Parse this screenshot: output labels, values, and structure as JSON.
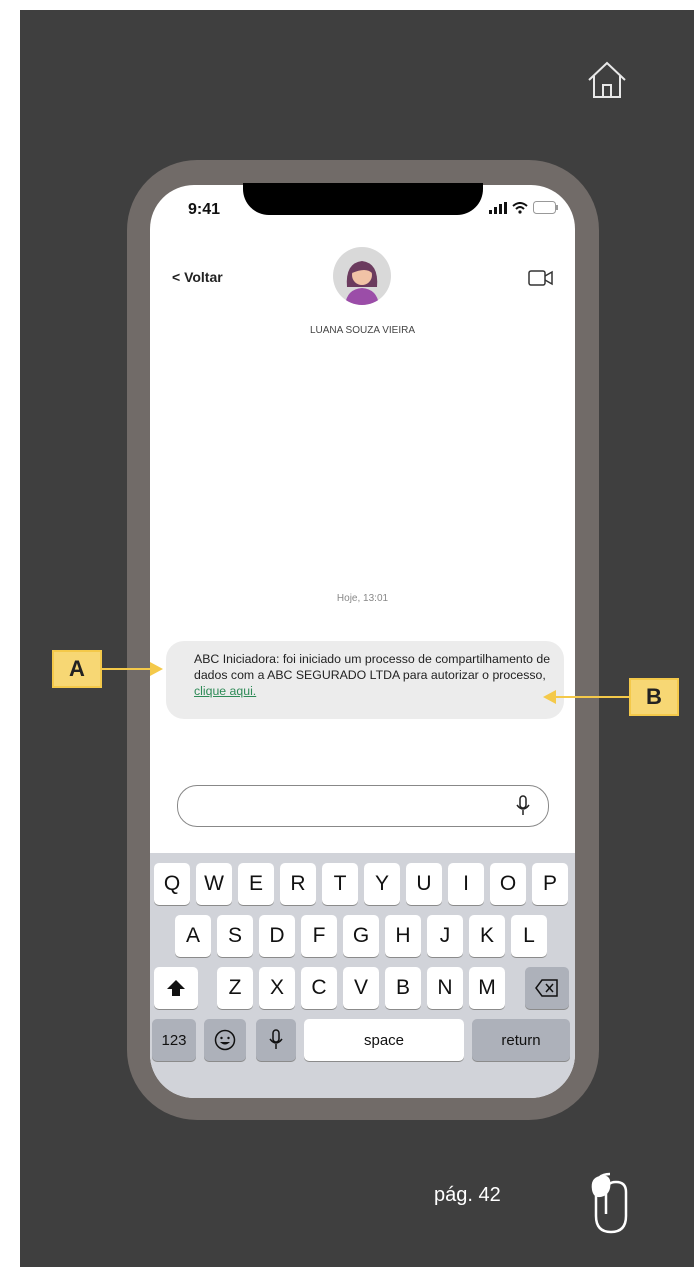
{
  "status_bar": {
    "time": "9:41"
  },
  "header": {
    "back_label": "< Voltar",
    "contact_name": "LUANA SOUZA VIEIRA"
  },
  "chat": {
    "timestamp": "Hoje, 13:01",
    "message_text": "ABC Iniciadora: foi iniciado um processo de compartilhamento de dados com a ABC SEGURADO LTDA para autorizar o processo,",
    "message_link": "clique aqui."
  },
  "keyboard": {
    "row1": [
      "Q",
      "W",
      "E",
      "R",
      "T",
      "Y",
      "U",
      "I",
      "O",
      "P"
    ],
    "row2": [
      "A",
      "S",
      "D",
      "F",
      "G",
      "H",
      "J",
      "K",
      "L"
    ],
    "row3": [
      "Z",
      "X",
      "C",
      "V",
      "B",
      "N",
      "M"
    ],
    "numbers_label": "123",
    "space_label": "space",
    "return_label": "return"
  },
  "callouts": {
    "a": "A",
    "b": "B"
  },
  "footer": {
    "page_label": "pág. 42"
  },
  "colors": {
    "background": "#3f3f3f",
    "frame": "#716b68",
    "callout": "#f7d774",
    "link": "#2e8b57"
  }
}
